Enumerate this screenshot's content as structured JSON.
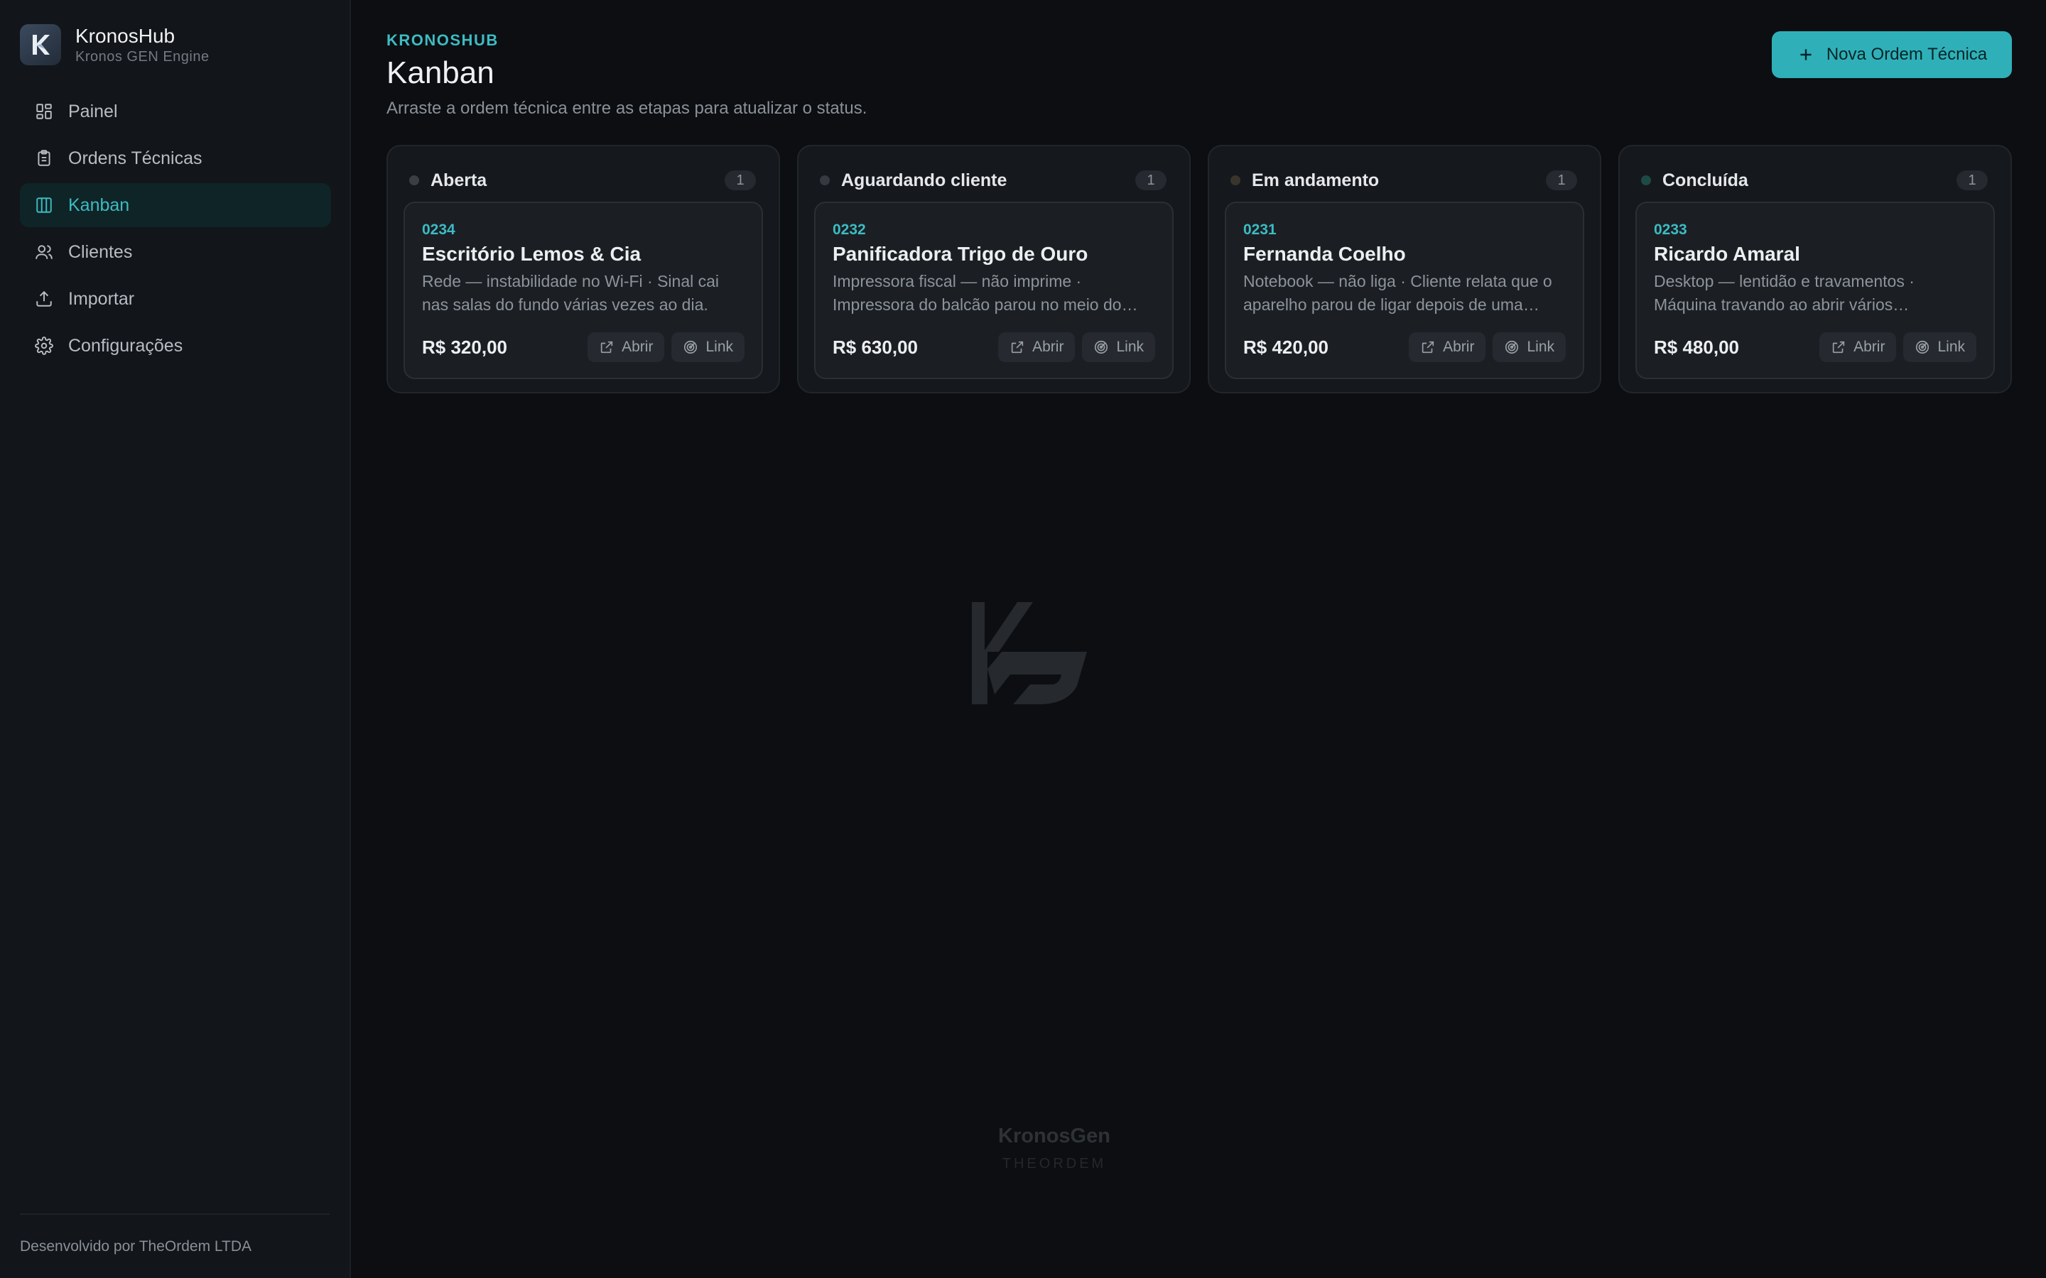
{
  "app": {
    "name": "KronosHub",
    "engine": "Kronos GEN Engine"
  },
  "sidebar": {
    "items": [
      {
        "label": "Painel",
        "icon": "dashboard-icon"
      },
      {
        "label": "Ordens Técnicas",
        "icon": "clipboard-icon"
      },
      {
        "label": "Kanban",
        "icon": "kanban-icon",
        "active": true
      },
      {
        "label": "Clientes",
        "icon": "users-icon"
      },
      {
        "label": "Importar",
        "icon": "upload-icon"
      },
      {
        "label": "Configurações",
        "icon": "gear-icon"
      }
    ],
    "footer": "Desenvolvido por TheOrdem LTDA"
  },
  "header": {
    "eyebrow": "KRONOSHUB",
    "title": "Kanban",
    "subtitle": "Arraste a ordem técnica entre as etapas para atualizar o status.",
    "new_button": "Nova Ordem Técnica"
  },
  "columns": [
    {
      "title": "Aberta",
      "count": "1",
      "dot_color": "#3a3f46",
      "card": {
        "id": "0234",
        "title": "Escritório Lemos & Cia",
        "desc": "Rede — instabilidade no Wi-Fi · Sinal cai nas salas do fundo várias vezes ao dia.",
        "price": "R$ 320,00",
        "open_label": "Abrir",
        "link_label": "Link"
      }
    },
    {
      "title": "Aguardando cliente",
      "count": "1",
      "dot_color": "#343a40",
      "card": {
        "id": "0232",
        "title": "Panificadora Trigo de Ouro",
        "desc": "Impressora fiscal — não imprime · Impressora do balcão parou no meio do expediente.",
        "price": "R$ 630,00",
        "open_label": "Abrir",
        "link_label": "Link"
      }
    },
    {
      "title": "Em andamento",
      "count": "1",
      "dot_color": "#3a352c",
      "card": {
        "id": "0231",
        "title": "Fernanda Coelho",
        "desc": "Notebook — não liga · Cliente relata que o aparelho parou de ligar depois de uma queda.",
        "price": "R$ 420,00",
        "open_label": "Abrir",
        "link_label": "Link"
      }
    },
    {
      "title": "Concluída",
      "count": "1",
      "dot_color": "#1d4a44",
      "card": {
        "id": "0233",
        "title": "Ricardo Amaral",
        "desc": "Desktop — lentidão e travamentos · Máquina travando ao abrir vários programas.",
        "price": "R$ 480,00",
        "open_label": "Abrir",
        "link_label": "Link"
      }
    }
  ],
  "watermark": {
    "brand": "KronosGen",
    "sub": "THEORDEM"
  },
  "colors": {
    "accent": "#3dbbc3",
    "button": "#2fb0b8",
    "background": "#0c0e11",
    "sidebar": "#121519"
  }
}
